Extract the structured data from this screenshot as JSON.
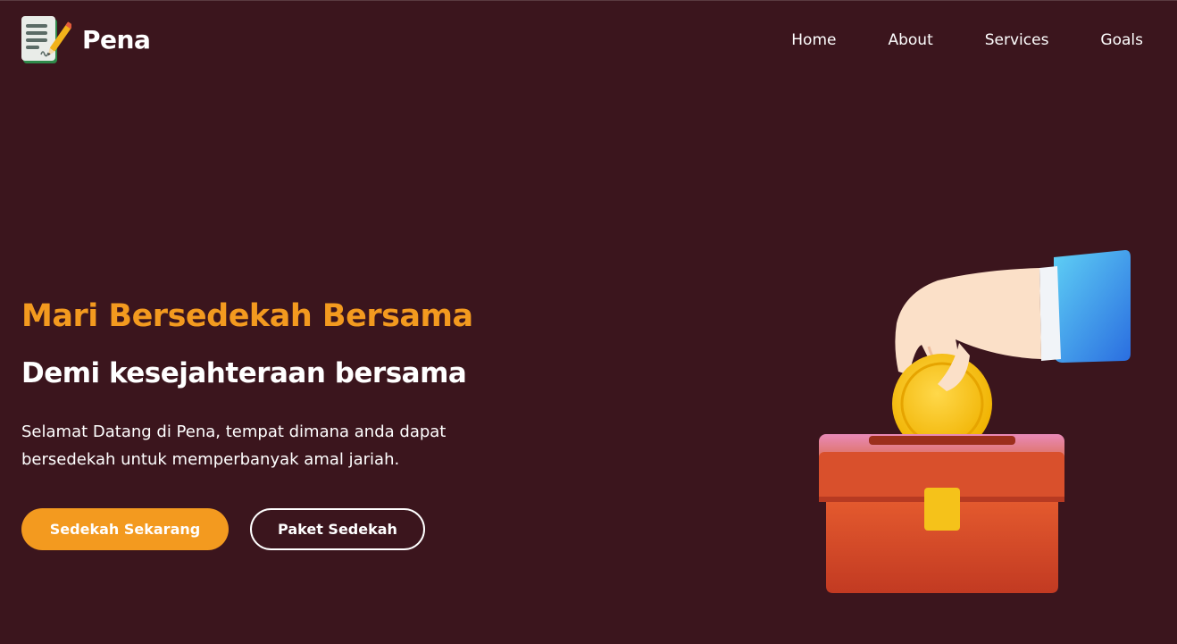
{
  "brand": {
    "name": "Pena",
    "logo_icon": "document-pen-icon"
  },
  "nav": {
    "items": [
      {
        "label": "Home"
      },
      {
        "label": "About"
      },
      {
        "label": "Services"
      },
      {
        "label": "Goals"
      }
    ]
  },
  "hero": {
    "title": "Mari Bersedekah Bersama",
    "subtitle": "Demi kesejahteraan bersama",
    "description": "Selamat Datang di Pena, tempat dimana anda dapat bersedekah untuk memperbanyak amal jariah.",
    "primary_button": "Sedekah Sekarang",
    "secondary_button": "Paket Sedekah",
    "illustration_icon": "donation-box-icon"
  },
  "colors": {
    "background": "#3b151d",
    "accent": "#f39a1f",
    "text": "#ffffff"
  }
}
